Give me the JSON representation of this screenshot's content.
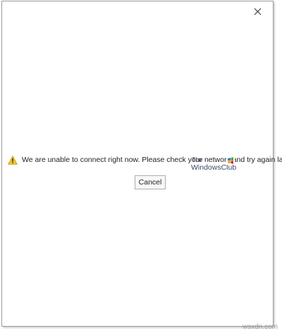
{
  "dialog": {
    "message": "We are unable to connect right now. Please check your network and try again later.",
    "cancel_label": "Cancel",
    "close_glyph": "✕",
    "warning_icon": "warning-icon"
  },
  "watermark": {
    "the": "The",
    "name": "WindowsClub"
  },
  "site_watermark": "wsxdn.com",
  "colors": {
    "warning_fill": "#f2c230",
    "border": "#9a9a9a",
    "button_border": "#adadad"
  }
}
